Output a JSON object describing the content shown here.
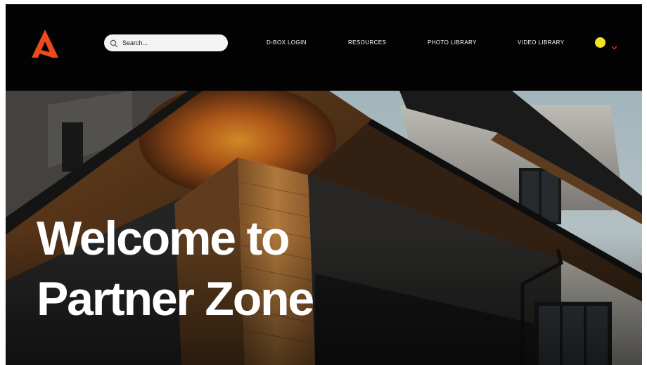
{
  "header": {
    "logo_icon": "a-mark-logo-icon",
    "brand_color": "#ee4a1b",
    "search": {
      "placeholder": "Search...",
      "value": "",
      "icon": "search-icon"
    },
    "nav": [
      {
        "label": "D-BOX LOGIN"
      },
      {
        "label": "RESOURCES"
      },
      {
        "label": "PHOTO LIBRARY"
      },
      {
        "label": "VIDEO LIBRARY"
      }
    ],
    "account": {
      "avatar_color": "#f2e22a",
      "chevron_icon": "chevron-down-icon",
      "chevron_color": "#ee4a1b"
    }
  },
  "hero": {
    "title_line1": "Welcome to",
    "title_line2": "Partner Zone"
  }
}
